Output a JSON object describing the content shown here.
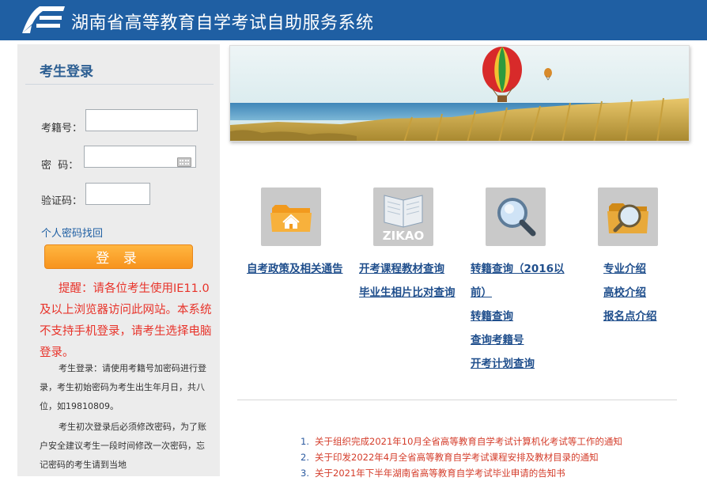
{
  "header": {
    "title": "湖南省高等教育自学考试自助服务系统"
  },
  "login": {
    "title": "考生登录",
    "id_label": "考籍号：",
    "id_value": "",
    "password_label": "密  码：",
    "password_value": "",
    "captcha_label": "验证码：",
    "captcha_value": "",
    "recover_link": "个人密码找回",
    "login_button": "登 录",
    "reminder": "提醒：请各位考生使用IE11.0及以上浏览器访问此网站。本系统不支持手机登录，请考生选择电脑登录。",
    "notice_1": "考生登录：请使用考籍号加密码进行登录，考生初始密码为考生出生年月日，共八位，如19810809。",
    "notice_2": "考生初次登录后必须修改密码，为了账户安全建议考生一段时间修改一次密码，忘记密码的考生请到当地"
  },
  "services": [
    {
      "icon": "folder-home-icon",
      "links": [
        "自考政策及相关通告"
      ]
    },
    {
      "icon": "zikao-book-icon",
      "icon_text": "ZIKAO",
      "links": [
        "开考课程教材查询",
        "毕业生相片比对查询"
      ]
    },
    {
      "icon": "magnifier-icon",
      "links": [
        "转籍查询（2016以",
        "前）",
        "转籍查询",
        "查询考籍号",
        "开考计划查询"
      ]
    },
    {
      "icon": "folder-search-icon",
      "links": [
        "专业介绍",
        "高校介绍",
        "报名点介绍"
      ]
    }
  ],
  "news": [
    {
      "num": "1.",
      "text": "关于组织完成2021年10月全省高等教育自学考试计算机化考试等工作的通知"
    },
    {
      "num": "2.",
      "text": "关于印发2022年4月全省高等教育自学考试课程安排及教材目录的通知"
    },
    {
      "num": "3.",
      "text": "关于2021年下半年湖南省高等教育自学考试毕业申请的告知书"
    }
  ],
  "colors": {
    "header_bg": "#1f5fa3",
    "accent_orange": "#f7931d",
    "reminder_red": "#e8332a",
    "link_blue": "#1f4e8c"
  }
}
